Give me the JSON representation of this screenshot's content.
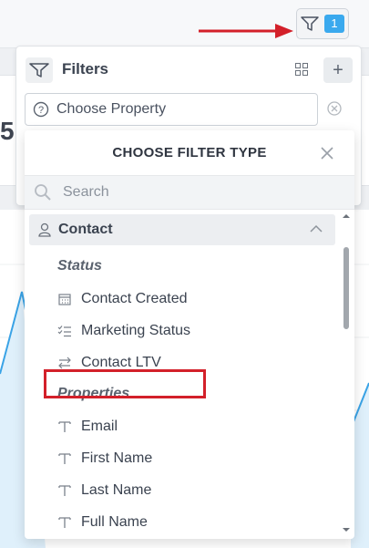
{
  "filter_button": {
    "count": "1"
  },
  "filters_panel": {
    "title": "Filters",
    "choose_property": "Choose Property",
    "add_label": "+"
  },
  "background": {
    "partial_number": "5"
  },
  "dropdown": {
    "title": "CHOOSE FILTER TYPE",
    "search_placeholder": "Search",
    "group": {
      "label": "Contact"
    },
    "sections": {
      "status": "Status",
      "properties": "Properties"
    },
    "status_items": [
      {
        "label": "Contact Created",
        "icon": "calendar-icon"
      },
      {
        "label": "Marketing Status",
        "icon": "list-check-icon"
      },
      {
        "label": "Contact LTV",
        "icon": "swap-arrows-icon"
      }
    ],
    "property_items": [
      {
        "label": "Email",
        "icon": "text-icon"
      },
      {
        "label": "First Name",
        "icon": "text-icon"
      },
      {
        "label": "Last Name",
        "icon": "text-icon"
      },
      {
        "label": "Full Name",
        "icon": "text-icon"
      }
    ]
  },
  "colors": {
    "badge": "#3aa9ee",
    "annotation_red": "#d3202a",
    "chart_line": "#3aa3e6"
  }
}
